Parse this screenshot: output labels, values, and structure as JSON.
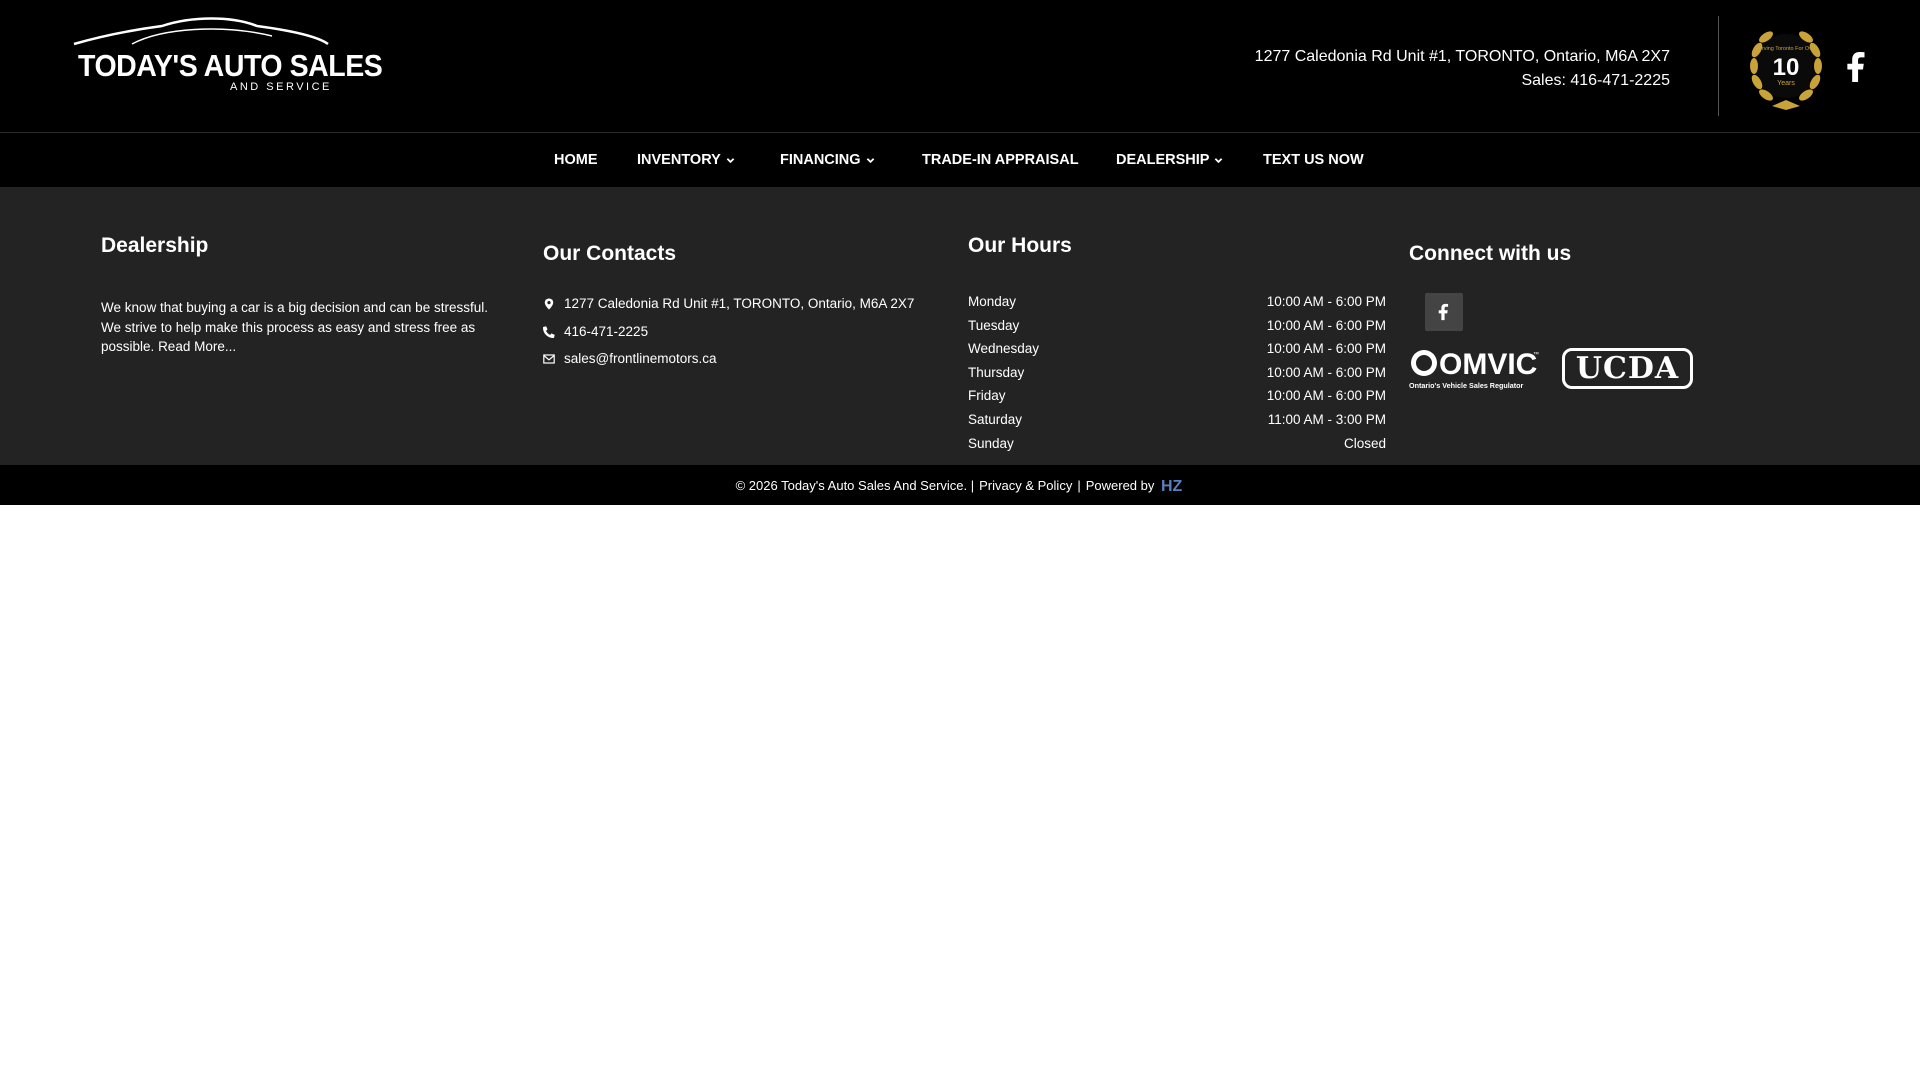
{
  "header": {
    "logo_title": "TODAY'S AUTO SALES",
    "logo_subtitle": "AND SERVICE",
    "address": "1277 Caledonia Rd Unit #1, TORONTO, Ontario, M6A 2X7",
    "sales": "Sales: 416-471-2225",
    "badge_top": "Serving Toronto For Over",
    "badge_number": "10",
    "badge_bottom": "Years",
    "facebook_icon": "facebook-icon"
  },
  "nav": {
    "items": [
      {
        "label": "HOME",
        "dropdown": false
      },
      {
        "label": "INVENTORY",
        "dropdown": true
      },
      {
        "label": "FINANCING",
        "dropdown": true
      },
      {
        "label": "TRADE-IN APPRAISAL",
        "dropdown": false
      },
      {
        "label": "DEALERSHIP",
        "dropdown": true
      },
      {
        "label": "TEXT US NOW",
        "dropdown": false
      }
    ]
  },
  "footer": {
    "dealership": {
      "title": "Dealership",
      "text": "We know that buying a car is a big decision and can be stressful. We strive to help make this process as easy and stress free as possible.",
      "read_more": "Read More..."
    },
    "contacts": {
      "title": "Our Contacts",
      "address": "1277 Caledonia Rd Unit #1, TORONTO, Ontario, M6A 2X7",
      "phone": "416-471-2225",
      "email": "sales@frontlinemotors.ca"
    },
    "hours": {
      "title": "Our Hours",
      "rows": [
        {
          "day": "Monday",
          "time": "10:00 AM - 6:00 PM"
        },
        {
          "day": "Tuesday",
          "time": "10:00 AM - 6:00 PM"
        },
        {
          "day": "Wednesday",
          "time": "10:00 AM - 6:00 PM"
        },
        {
          "day": "Thursday",
          "time": "10:00 AM - 6:00 PM"
        },
        {
          "day": "Friday",
          "time": "10:00 AM - 6:00 PM"
        },
        {
          "day": "Saturday",
          "time": "11:00 AM - 3:00 PM"
        },
        {
          "day": "Sunday",
          "time": "Closed"
        }
      ]
    },
    "connect": {
      "title": "Connect with us",
      "omvic": "OMVIC",
      "omvic_tag": "™",
      "omvic_sub": "Ontario's Vehicle Sales Regulator",
      "ucda": "UCDA"
    }
  },
  "bottom": {
    "copyright": "© 2026 Today's Auto Sales And Service. |",
    "privacy": "Privacy & Policy",
    "separator": "|",
    "powered": "Powered by",
    "powered_logo": "HZ"
  },
  "colors": {
    "header_bg": "#000000",
    "footer_bg": "#232323",
    "badge_gold": "#c9a23a"
  }
}
